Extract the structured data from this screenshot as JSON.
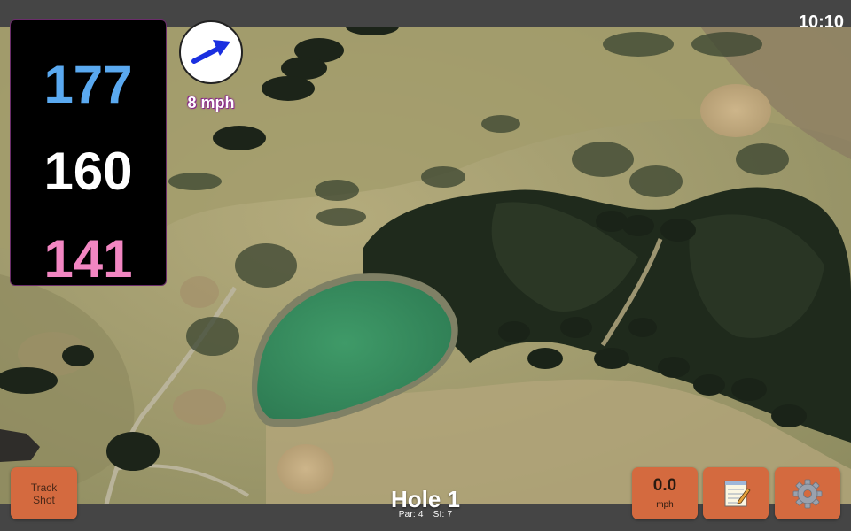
{
  "status": {
    "time": "10:10"
  },
  "distances": {
    "back": "177",
    "center": "160",
    "front": "141"
  },
  "wind": {
    "speed": "8 mph"
  },
  "hole": {
    "title": "Hole 1",
    "par": "Par: 4",
    "si": "SI: 7"
  },
  "buttons": {
    "track_shot_line1": "Track",
    "track_shot_line2": "Shot",
    "speed_value": "0.0",
    "speed_unit": "mph",
    "notes_icon": "notepad-icon",
    "settings_icon": "gear-icon"
  },
  "colors": {
    "back_distance": "#5aa9f0",
    "center_distance": "#ffffff",
    "front_distance": "#f286c2",
    "button": "#d46a3f",
    "wind_arrow": "#1a2fe0"
  }
}
